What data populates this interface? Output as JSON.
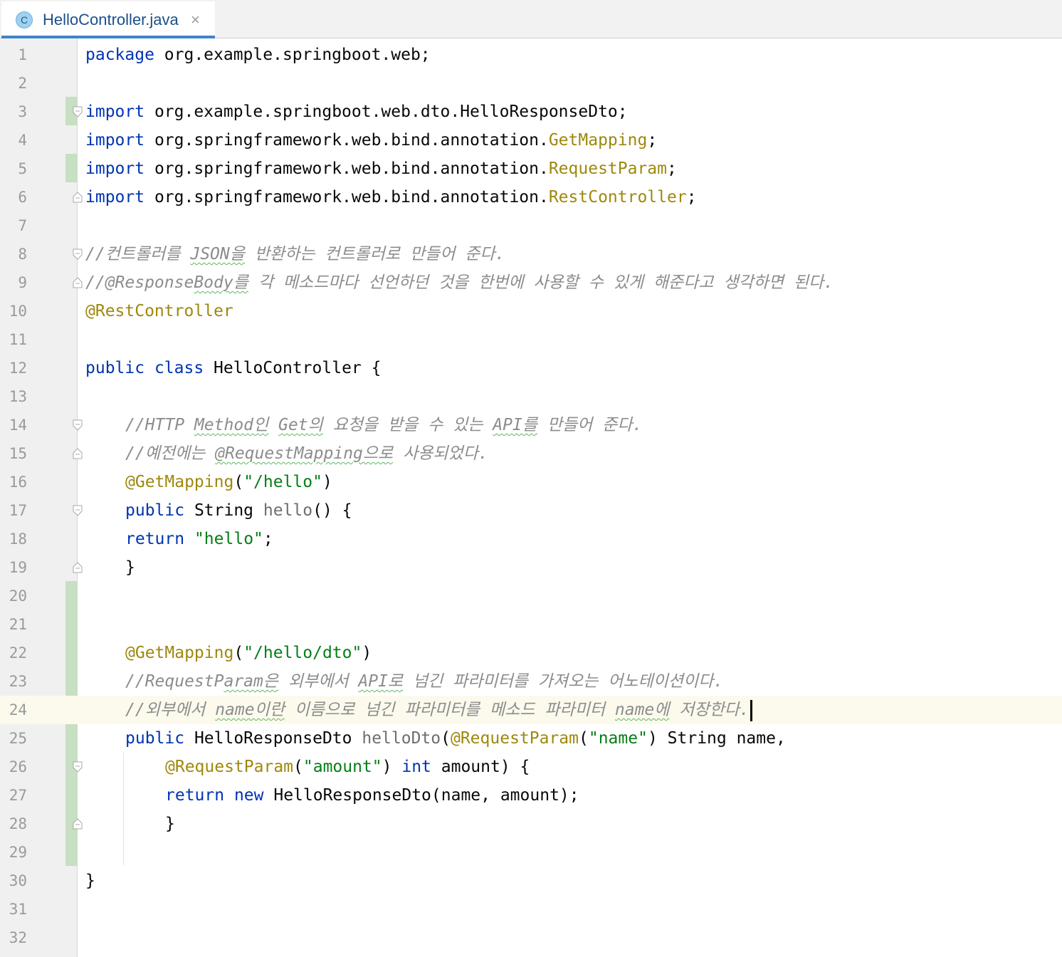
{
  "tab": {
    "title": "HelloController.java",
    "icon_letter": "C",
    "icon": "class-icon",
    "close_glyph": "×"
  },
  "line_numbers": [
    "1",
    "2",
    "3",
    "4",
    "5",
    "6",
    "7",
    "8",
    "9",
    "10",
    "11",
    "12",
    "13",
    "14",
    "15",
    "16",
    "17",
    "18",
    "19",
    "20",
    "21",
    "22",
    "23",
    "24",
    "25",
    "26",
    "27",
    "28",
    "29",
    "30",
    "31",
    "32"
  ],
  "code": {
    "l1": [
      "package",
      " org.example.springboot.web;"
    ],
    "l3": [
      "import",
      " org.example.springboot.web.dto.HelloResponseDto;"
    ],
    "l4": [
      "import",
      " org.springframework.web.bind.annotation.",
      "GetMapping",
      ";"
    ],
    "l5": [
      "import",
      " org.springframework.web.bind.annotation.",
      "RequestParam",
      ";"
    ],
    "l6": [
      "import",
      " org.springframework.web.bind.annotation.",
      "RestController",
      ";"
    ],
    "l8": [
      "//컨트롤러를 ",
      "JSON을",
      " 반환하는 컨트롤러로 만들어 준다."
    ],
    "l9": [
      "//@Response",
      "Body를",
      " 각 메소드마다 선언하던 것을 한번에 사용할 수 있게 해준다고 생각하면 된다."
    ],
    "l10": [
      "@RestController"
    ],
    "l12": [
      "public",
      " ",
      "class",
      " HelloController {"
    ],
    "l14": [
      "//HTTP ",
      "Method인",
      " ",
      "Get의",
      " 요청을 받을 수 있는 ",
      "API를",
      " 만들어 준다."
    ],
    "l15": [
      "//예전에는 ",
      "@RequestMapping으로",
      " 사용되었다."
    ],
    "l16": [
      "@GetMapping",
      "(",
      "\"/hello\"",
      ")"
    ],
    "l17": [
      "public",
      " String ",
      "hello",
      "() {"
    ],
    "l18": [
      "return",
      " ",
      "\"hello\"",
      ";"
    ],
    "l19": [
      "}"
    ],
    "l22": [
      "@GetMapping",
      "(",
      "\"/hello/dto\"",
      ")"
    ],
    "l23": [
      "//RequestP",
      "aram은",
      " 외부에서 ",
      "API로",
      " 넘긴 파라미터를 가져오는 어노테이션이다."
    ],
    "l24": [
      "//외부에서 ",
      "name이란",
      " 이름으로 넘긴 파라미터를 메소드 파라미터 ",
      "name에",
      " 저장한다."
    ],
    "l25": [
      "public",
      " HelloResponseDto ",
      "helloDto",
      "(",
      "@RequestParam",
      "(",
      "\"name\"",
      ") String name,"
    ],
    "l26": [
      "@RequestParam",
      "(",
      "\"amount\"",
      ") ",
      "int",
      " amount) {"
    ],
    "l27": [
      "return",
      " ",
      "new",
      " HelloResponseDto(name, amount);"
    ],
    "l28": [
      "}"
    ],
    "l30": [
      "}"
    ]
  },
  "colors": {
    "keyword": "#0033b3",
    "annotation": "#9e880d",
    "string": "#067d17",
    "comment": "#8c8c8c",
    "method": "#6e6e6e",
    "change_marker": "#c7dfc2",
    "current_line": "#fcfaed",
    "tab_underline": "#4083c9"
  },
  "current_line": 24
}
